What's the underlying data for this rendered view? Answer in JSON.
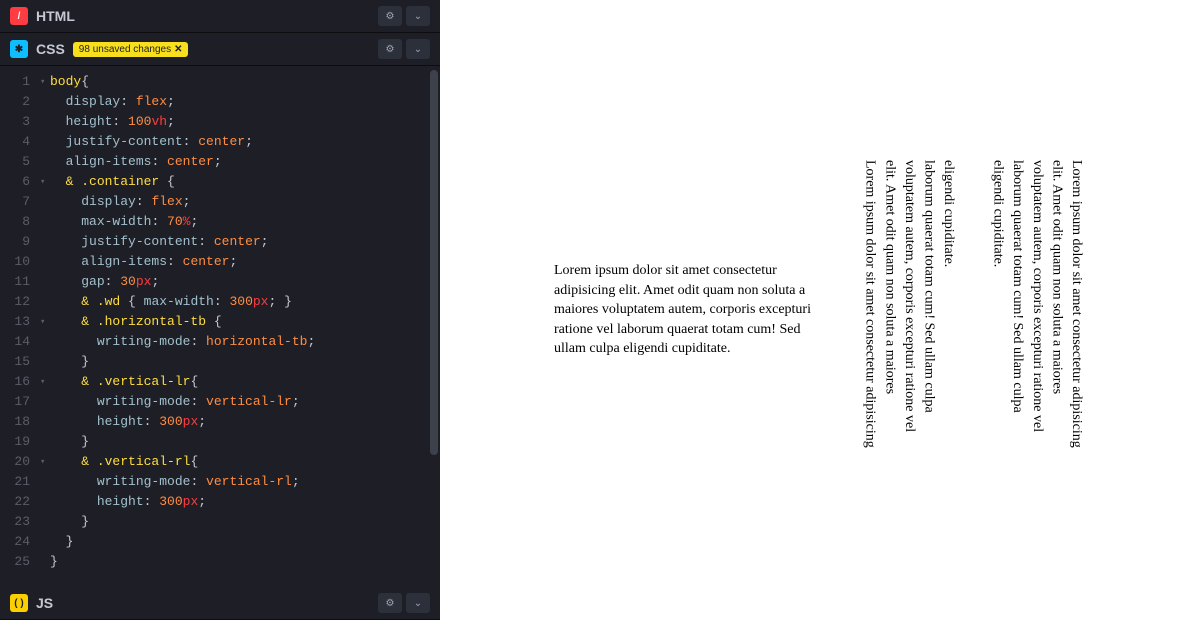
{
  "panels": {
    "html": {
      "title": "HTML",
      "icon_glyph": "/"
    },
    "css": {
      "title": "CSS",
      "icon_glyph": "✱",
      "badge": "98 unsaved changes",
      "badge_close": "✕"
    },
    "js": {
      "title": "JS",
      "icon_glyph": "( )"
    }
  },
  "icons": {
    "gear": "⚙",
    "chevron": "⌄"
  },
  "code_lines": [
    {
      "n": "1",
      "fold": "▾",
      "tokens": [
        [
          "sel",
          "body"
        ],
        [
          "punc",
          "{"
        ]
      ]
    },
    {
      "n": "2",
      "fold": "",
      "indent": 1,
      "tokens": [
        [
          "prop",
          "display"
        ],
        [
          "punc",
          ": "
        ],
        [
          "val",
          "flex"
        ],
        [
          "punc",
          ";"
        ]
      ]
    },
    {
      "n": "3",
      "fold": "",
      "indent": 1,
      "tokens": [
        [
          "prop",
          "height"
        ],
        [
          "punc",
          ": "
        ],
        [
          "val",
          "100"
        ],
        [
          "unit",
          "vh"
        ],
        [
          "punc",
          ";"
        ]
      ]
    },
    {
      "n": "4",
      "fold": "",
      "indent": 1,
      "tokens": [
        [
          "prop",
          "justify-content"
        ],
        [
          "punc",
          ": "
        ],
        [
          "val",
          "center"
        ],
        [
          "punc",
          ";"
        ]
      ]
    },
    {
      "n": "5",
      "fold": "",
      "indent": 1,
      "tokens": [
        [
          "prop",
          "align-items"
        ],
        [
          "punc",
          ": "
        ],
        [
          "val",
          "center"
        ],
        [
          "punc",
          ";"
        ]
      ]
    },
    {
      "n": "6",
      "fold": "▾",
      "indent": 1,
      "tokens": [
        [
          "sel",
          "& .container "
        ],
        [
          "punc",
          "{"
        ]
      ]
    },
    {
      "n": "7",
      "fold": "",
      "indent": 2,
      "tokens": [
        [
          "prop",
          "display"
        ],
        [
          "punc",
          ": "
        ],
        [
          "val",
          "flex"
        ],
        [
          "punc",
          ";"
        ]
      ]
    },
    {
      "n": "8",
      "fold": "",
      "indent": 2,
      "tokens": [
        [
          "prop",
          "max-width"
        ],
        [
          "punc",
          ": "
        ],
        [
          "val",
          "70"
        ],
        [
          "unit",
          "%"
        ],
        [
          "punc",
          ";"
        ]
      ]
    },
    {
      "n": "9",
      "fold": "",
      "indent": 2,
      "tokens": [
        [
          "prop",
          "justify-content"
        ],
        [
          "punc",
          ": "
        ],
        [
          "val",
          "center"
        ],
        [
          "punc",
          ";"
        ]
      ]
    },
    {
      "n": "10",
      "fold": "",
      "indent": 2,
      "tokens": [
        [
          "prop",
          "align-items"
        ],
        [
          "punc",
          ": "
        ],
        [
          "val",
          "center"
        ],
        [
          "punc",
          ";"
        ]
      ]
    },
    {
      "n": "11",
      "fold": "",
      "indent": 2,
      "tokens": [
        [
          "prop",
          "gap"
        ],
        [
          "punc",
          ": "
        ],
        [
          "val",
          "30"
        ],
        [
          "unit",
          "px"
        ],
        [
          "punc",
          ";"
        ]
      ]
    },
    {
      "n": "12",
      "fold": "",
      "indent": 2,
      "tokens": [
        [
          "sel",
          "& .wd "
        ],
        [
          "punc",
          "{ "
        ],
        [
          "prop",
          "max-width"
        ],
        [
          "punc",
          ": "
        ],
        [
          "val",
          "300"
        ],
        [
          "unit",
          "px"
        ],
        [
          "punc",
          "; } "
        ]
      ]
    },
    {
      "n": "13",
      "fold": "▾",
      "indent": 2,
      "tokens": [
        [
          "sel",
          "& .horizontal-tb "
        ],
        [
          "punc",
          "{"
        ]
      ]
    },
    {
      "n": "14",
      "fold": "",
      "indent": 3,
      "tokens": [
        [
          "prop",
          "writing-mode"
        ],
        [
          "punc",
          ": "
        ],
        [
          "val",
          "horizontal-tb"
        ],
        [
          "punc",
          ";"
        ]
      ]
    },
    {
      "n": "15",
      "fold": "",
      "indent": 2,
      "tokens": [
        [
          "punc",
          "}"
        ]
      ]
    },
    {
      "n": "16",
      "fold": "▾",
      "indent": 2,
      "tokens": [
        [
          "sel",
          "& .vertical-lr"
        ],
        [
          "punc",
          "{"
        ]
      ]
    },
    {
      "n": "17",
      "fold": "",
      "indent": 3,
      "tokens": [
        [
          "prop",
          "writing-mode"
        ],
        [
          "punc",
          ": "
        ],
        [
          "val",
          "vertical-lr"
        ],
        [
          "punc",
          ";"
        ]
      ]
    },
    {
      "n": "18",
      "fold": "",
      "indent": 3,
      "tokens": [
        [
          "prop",
          "height"
        ],
        [
          "punc",
          ": "
        ],
        [
          "val",
          "300"
        ],
        [
          "unit",
          "px"
        ],
        [
          "punc",
          ";"
        ]
      ]
    },
    {
      "n": "19",
      "fold": "",
      "indent": 2,
      "tokens": [
        [
          "punc",
          "}"
        ]
      ]
    },
    {
      "n": "20",
      "fold": "▾",
      "indent": 2,
      "tokens": [
        [
          "sel",
          "& .vertical-rl"
        ],
        [
          "punc",
          "{"
        ]
      ]
    },
    {
      "n": "21",
      "fold": "",
      "indent": 3,
      "tokens": [
        [
          "prop",
          "writing-mode"
        ],
        [
          "punc",
          ": "
        ],
        [
          "val",
          "vertical-rl"
        ],
        [
          "punc",
          ";"
        ]
      ]
    },
    {
      "n": "22",
      "fold": "",
      "indent": 3,
      "tokens": [
        [
          "prop",
          "height"
        ],
        [
          "punc",
          ": "
        ],
        [
          "val",
          "300"
        ],
        [
          "unit",
          "px"
        ],
        [
          "punc",
          ";"
        ]
      ]
    },
    {
      "n": "23",
      "fold": "",
      "indent": 2,
      "tokens": [
        [
          "punc",
          "}"
        ]
      ]
    },
    {
      "n": "24",
      "fold": "",
      "indent": 1,
      "tokens": [
        [
          "punc",
          "}"
        ]
      ]
    },
    {
      "n": "25",
      "fold": "",
      "indent": 0,
      "tokens": [
        [
          "punc",
          "}"
        ]
      ]
    }
  ],
  "preview": {
    "text": "Lorem ipsum dolor sit amet consectetur adipisicing elit. Amet odit quam non soluta a maiores voluptatem autem, corporis excepturi ratione vel laborum quaerat totam cum! Sed ullam culpa eligendi cupiditate."
  }
}
